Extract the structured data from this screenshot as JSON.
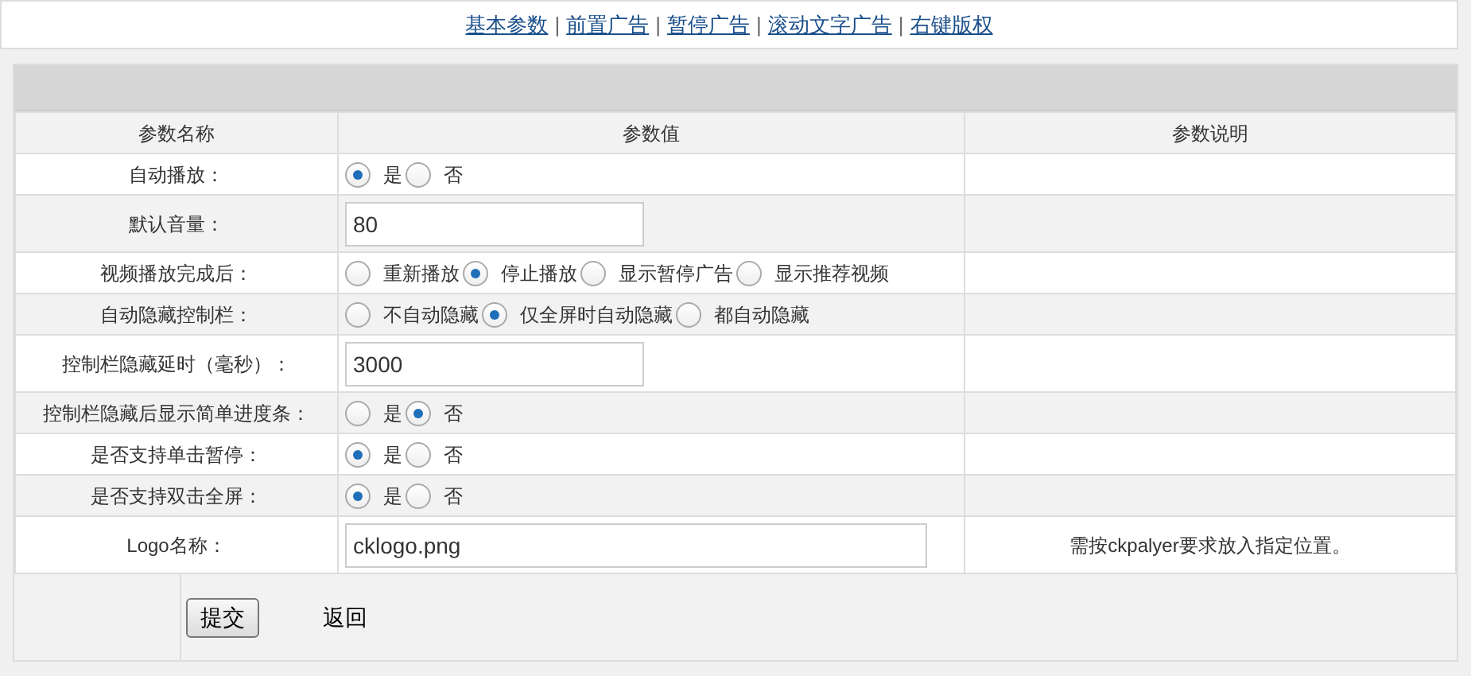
{
  "nav_links": [
    {
      "label": "基本参数"
    },
    {
      "label": "前置广告"
    },
    {
      "label": "暂停广告"
    },
    {
      "label": "滚动文字广告"
    },
    {
      "label": "右键版权"
    }
  ],
  "nav_separator": "|",
  "table": {
    "columns": [
      "参数名称",
      "参数值",
      "参数说明"
    ],
    "rows": [
      {
        "name": "自动播放：",
        "kind": "radio",
        "options": [
          {
            "label": "是",
            "selected": true
          },
          {
            "label": "否",
            "selected": false
          }
        ]
      },
      {
        "name": "默认音量：",
        "kind": "text",
        "value": "80",
        "wide": false
      },
      {
        "name": "视频播放完成后：",
        "kind": "radio",
        "options": [
          {
            "label": "重新播放",
            "selected": false
          },
          {
            "label": "停止播放",
            "selected": true
          },
          {
            "label": "显示暂停广告",
            "selected": false
          },
          {
            "label": "显示推荐视频",
            "selected": false
          }
        ]
      },
      {
        "name": "自动隐藏控制栏：",
        "kind": "radio",
        "options": [
          {
            "label": "不自动隐藏",
            "selected": false
          },
          {
            "label": "仅全屏时自动隐藏",
            "selected": true
          },
          {
            "label": "都自动隐藏",
            "selected": false
          }
        ]
      },
      {
        "name": "控制栏隐藏延时（毫秒）：",
        "kind": "text",
        "value": "3000",
        "wide": false
      },
      {
        "name": "控制栏隐藏后显示简单进度条：",
        "kind": "radio",
        "options": [
          {
            "label": "是",
            "selected": false
          },
          {
            "label": "否",
            "selected": true
          }
        ]
      },
      {
        "name": "是否支持单击暂停：",
        "kind": "radio",
        "options": [
          {
            "label": "是",
            "selected": true
          },
          {
            "label": "否",
            "selected": false
          }
        ]
      },
      {
        "name": "是否支持双击全屏：",
        "kind": "radio",
        "options": [
          {
            "label": "是",
            "selected": true
          },
          {
            "label": "否",
            "selected": false
          }
        ]
      },
      {
        "name": "Logo名称：",
        "kind": "text",
        "value": "cklogo.png",
        "wide": true,
        "note": "需按ckpalyer要求放入指定位置。"
      }
    ]
  },
  "submit_button": "提交",
  "back_link": "返回"
}
